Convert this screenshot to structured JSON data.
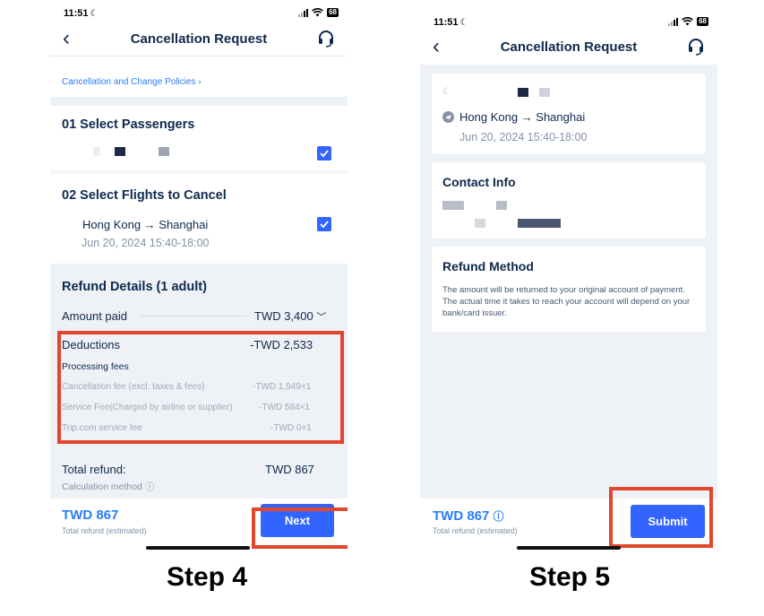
{
  "common": {
    "time": "11:51",
    "battery": "68",
    "nav_title": "Cancellation Request"
  },
  "step4": {
    "policy_link": "Cancellation and Change Policies",
    "passengers_title": "01  Select Passengers",
    "flights_title": "02  Select Flights to Cancel",
    "route": "Hong Kong → Shanghai",
    "flight_time": "Jun 20, 2024   15:40-18:00",
    "refund_title": "Refund Details (1 adult)",
    "amount_paid_label": "Amount paid",
    "amount_paid_value": "TWD 3,400",
    "deductions_label": "Deductions",
    "deductions_value": "-TWD 2,533",
    "processing_label": "Processing fees",
    "fees": [
      {
        "label": "Cancellation fee (excl. taxes & fees)",
        "value": "-TWD 1,949×1"
      },
      {
        "label": "Service Fee(Charged by airline or supplier)",
        "value": "-TWD 584×1"
      },
      {
        "label": "Trip.com service fee",
        "value": "-TWD 0×1"
      }
    ],
    "total_label": "Total refund:",
    "total_value": "TWD 867",
    "calc_label": "Calculation method",
    "footer_amount": "TWD 867",
    "footer_hint": "Total refund (estimated)",
    "next_label": "Next",
    "step_label": "Step 4"
  },
  "step5": {
    "route": "Hong Kong → Shanghai",
    "flight_time": "Jun 20, 2024   15:40-18:00",
    "contact_title": "Contact Info",
    "refund_method_title": "Refund Method",
    "refund_method_text": "The amount will be returned to your original account of payment. The actual time it takes to reach your account will depend on your bank/card issuer.",
    "footer_amount": "TWD 867",
    "footer_hint": "Total refund (estimated)",
    "submit_label": "Submit",
    "step_label": "Step 5"
  },
  "colors": {
    "accent": "#3264ff",
    "link": "#287dfa",
    "highlight": "#e2462d",
    "text": "#0f294d",
    "muted": "#8592a6",
    "background_grey": "#eef1f6"
  }
}
